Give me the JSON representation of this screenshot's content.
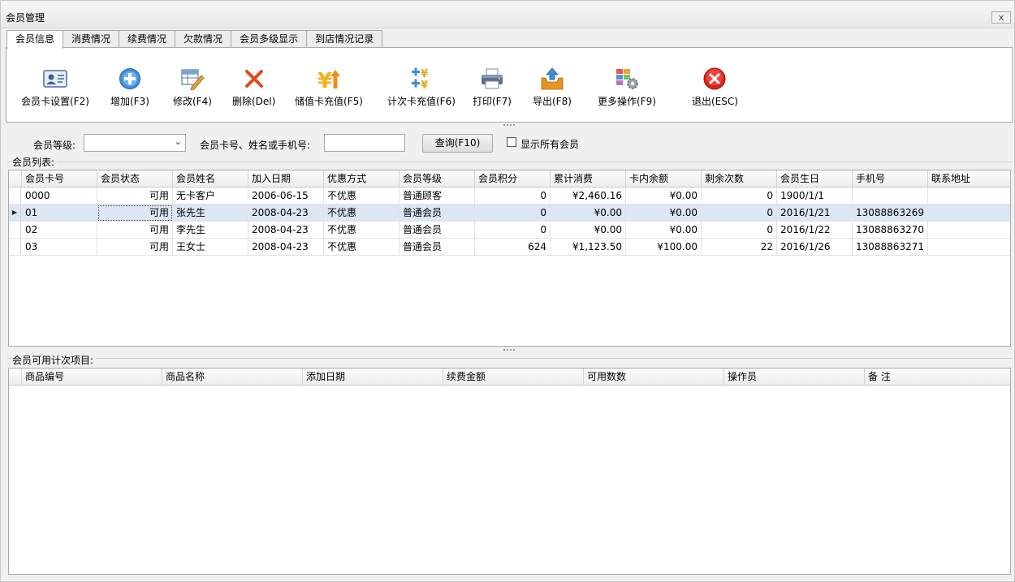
{
  "window": {
    "title": "会员管理",
    "close_label": "x"
  },
  "tabs": [
    {
      "label": "会员信息",
      "active": true
    },
    {
      "label": "消费情况"
    },
    {
      "label": "续费情况"
    },
    {
      "label": "欠款情况"
    },
    {
      "label": "会员多级显示"
    },
    {
      "label": "到店情况记录"
    }
  ],
  "toolbar": {
    "card_settings": "会员卡设置(F2)",
    "add": "增加(F3)",
    "edit": "修改(F4)",
    "delete": "删除(Del)",
    "stored_value_recharge": "储值卡充值(F5)",
    "count_card_recharge": "计次卡充值(F6)",
    "print": "打印(F7)",
    "export": "导出(F8)",
    "more": "更多操作(F9)",
    "exit": "退出(ESC)"
  },
  "filter": {
    "level_label": "会员等级:",
    "level_value": "",
    "search_label": "会员卡号、姓名或手机号:",
    "search_value": "",
    "query_button": "查询(F10)",
    "show_all_label": "显示所有会员",
    "show_all_checked": false
  },
  "member_list": {
    "title": "会员列表:",
    "columns": [
      "会员卡号",
      "会员状态",
      "会员姓名",
      "加入日期",
      "优惠方式",
      "会员等级",
      "会员积分",
      "累计消费",
      "卡内余额",
      "剩余次数",
      "会员生日",
      "手机号",
      "联系地址"
    ],
    "rows": [
      [
        "0000",
        "可用",
        "无卡客户",
        "2006-06-15",
        "不优惠",
        "普通顾客",
        "0",
        "¥2,460.16",
        "¥0.00",
        "0",
        "1900/1/1",
        "",
        ""
      ],
      [
        "01",
        "可用",
        "张先生",
        "2008-04-23",
        "不优惠",
        "普通会员",
        "0",
        "¥0.00",
        "¥0.00",
        "0",
        "2016/1/21",
        "13088863269",
        ""
      ],
      [
        "02",
        "可用",
        "李先生",
        "2008-04-23",
        "不优惠",
        "普通会员",
        "0",
        "¥0.00",
        "¥0.00",
        "0",
        "2016/1/22",
        "13088863270",
        ""
      ],
      [
        "03",
        "可用",
        "王女士",
        "2008-04-23",
        "不优惠",
        "普通会员",
        "624",
        "¥1,123.50",
        "¥100.00",
        "22",
        "2016/1/26",
        "13088863271",
        ""
      ]
    ],
    "selected_row": 1
  },
  "count_items": {
    "title": "会员可用计次项目:",
    "columns": [
      "商品编号",
      "商品名称",
      "添加日期",
      "续费金额",
      "可用数数",
      "操作员",
      "备 注"
    ],
    "rows": []
  },
  "colors": {
    "selected_row": "#dce6f4",
    "toolbar_bg": "#ffffff",
    "window_bg": "#f0f0f0"
  }
}
